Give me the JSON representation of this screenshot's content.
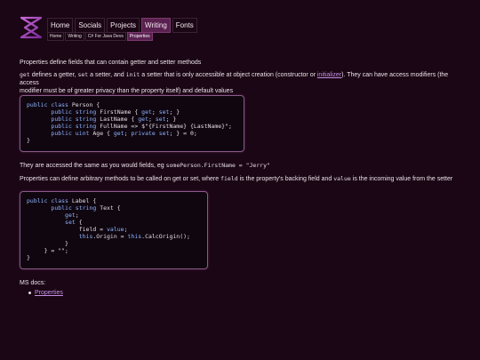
{
  "nav": {
    "items": [
      {
        "label": "Home"
      },
      {
        "label": "Socials"
      },
      {
        "label": "Projects"
      },
      {
        "label": "Writing"
      },
      {
        "label": "Fonts"
      }
    ],
    "active_index": 3
  },
  "breadcrumb": [
    "Home",
    "Writing",
    "C# For Java Devs",
    "Properties"
  ],
  "content": {
    "intro": "Properties define fields that can contain getter and setter methods",
    "p2": {
      "t1": "get",
      "t2": " defines a getter, ",
      "t3": "set",
      "t4": " a setter, and ",
      "t5": "init",
      "t6": " a setter that is only accessible at object creation (constructor or ",
      "link": "initializer",
      "t7": "). They can have access modifiers (the access",
      "line2": "modifier must be of greater privacy than the property itself) and default values"
    },
    "code1": [
      "public class Person {",
      "    public string FirstName { get; set; }",
      "    public string LastName { get; set; }",
      "    public string FullName => $\"{FirstName} {LastName}\";",
      "    public uint Age { get; private set; } = 0;",
      "}"
    ],
    "p3": {
      "t1": "They are accessed the same as you would fields, eg ",
      "code": "somePerson.FirstName = \"Jerry\""
    },
    "p4": {
      "t1": "Properties can define arbitrary methods to be called on get or set, where ",
      "c1": "field",
      "t2": " is the property's backing field and ",
      "c2": "value",
      "t3": " is the incoming value from the setter"
    },
    "code2": [
      "public class Label {",
      "    public string Text {",
      "        get;",
      "        set {",
      "            field = value;",
      "            this.Origin = this.CalcOrigin();",
      "        }",
      "    } = \"\";",
      "}"
    ],
    "ms_docs": "MS docs:",
    "docs_links": [
      "Properties"
    ]
  },
  "colors": {
    "background": "#1a0614",
    "accent": "#5a2150",
    "link": "#c48ee6",
    "code_border": "#8a5a88"
  }
}
